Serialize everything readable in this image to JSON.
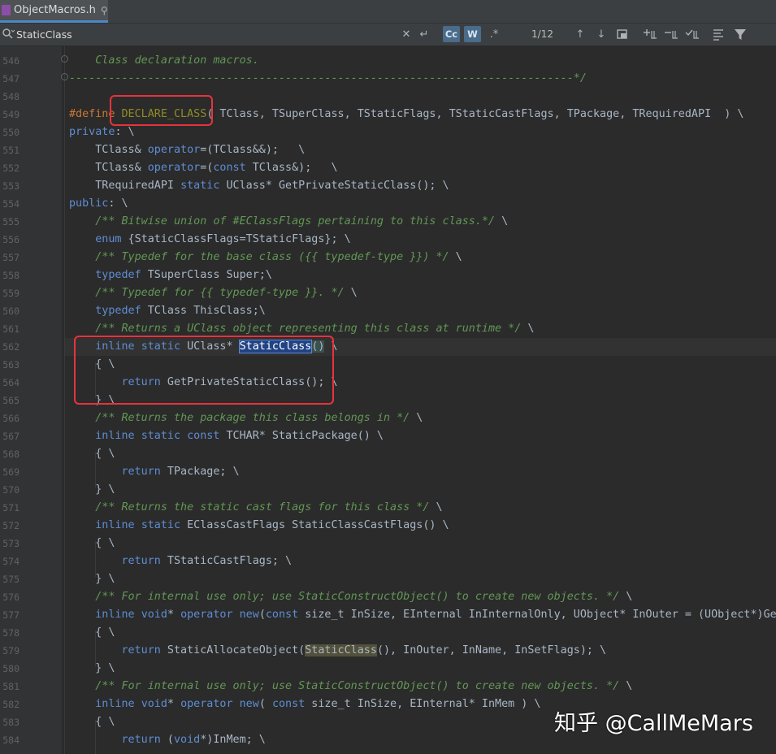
{
  "tab": {
    "title": "ObjectMacros.h",
    "pin_glyph": "⚲"
  },
  "search": {
    "query": "StaticClass",
    "match_case_label": "Cc",
    "words_label": "W",
    "regex_label": ".*",
    "match_count": "1/12"
  },
  "lines": [
    {
      "n": "546",
      "html": "    <span class=\"cm\">Class declaration macros.</span>"
    },
    {
      "n": "547",
      "html": "<span class=\"cm\">-----------------------------------------------------------------------------*/</span>"
    },
    {
      "n": "548",
      "html": ""
    },
    {
      "n": "549",
      "html": "<span class=\"kw\">#define</span> <span class=\"mac\">DECLARE_CLASS</span>( TClass, TSuperClass, TStaticFlags, TStaticCastFlags, TPackage, TRequiredAPI  ) \\"
    },
    {
      "n": "550",
      "html": "<span class=\"kwbl\">private</span>: \\"
    },
    {
      "n": "551",
      "html": "    TClass&amp; <span class=\"op\">operator</span>=(TClass&amp;&amp;);   \\"
    },
    {
      "n": "552",
      "html": "    TClass&amp; <span class=\"op\">operator</span>=(<span class=\"kwbl\">const</span> TClass&amp;);   \\"
    },
    {
      "n": "553",
      "html": "    TRequiredAPI <span class=\"kwbl\">static</span> UClass* GetPrivateStaticClass(); \\"
    },
    {
      "n": "554",
      "html": "<span class=\"kwbl\">public</span>: \\"
    },
    {
      "n": "555",
      "html": "    <span class=\"cm\">/** Bitwise union of #EClassFlags pertaining to this class.*/</span> \\"
    },
    {
      "n": "556",
      "html": "    <span class=\"kwbl\">enum</span> {StaticClassFlags=TStaticFlags}; \\"
    },
    {
      "n": "557",
      "html": "    <span class=\"cm\">/** Typedef for the base class ({{ typedef-type }}) */</span> \\"
    },
    {
      "n": "558",
      "html": "    <span class=\"kwbl\">typedef</span> TSuperClass Super;\\"
    },
    {
      "n": "559",
      "html": "    <span class=\"cm\">/** Typedef for {{ typedef-type }}. */</span> \\"
    },
    {
      "n": "560",
      "html": "    <span class=\"kwbl\">typedef</span> TClass ThisClass;\\"
    },
    {
      "n": "561",
      "html": "    <span class=\"cm\">/** Returns a UClass object representing this class at runtime */</span> \\"
    },
    {
      "n": "562",
      "html": "    <span class=\"kwbl\">inline</span> <span class=\"kwbl\">static</span> UClass* <span class=\"sel\">StaticClass</span><span class=\"paren\">()</span> \\"
    },
    {
      "n": "563",
      "html": "    { \\"
    },
    {
      "n": "564",
      "html": "        <span class=\"kwbl\">return</span> GetPrivateStaticClass(); \\"
    },
    {
      "n": "565",
      "html": "    } \\"
    },
    {
      "n": "566",
      "html": "    <span class=\"cm\">/** Returns the package this class belongs in */</span> \\"
    },
    {
      "n": "567",
      "html": "    <span class=\"kwbl\">inline</span> <span class=\"kwbl\">static</span> <span class=\"kwbl\">const</span> TCHAR* StaticPackage() \\"
    },
    {
      "n": "568",
      "html": "    { \\"
    },
    {
      "n": "569",
      "html": "        <span class=\"kwbl\">return</span> TPackage; \\"
    },
    {
      "n": "570",
      "html": "    } \\"
    },
    {
      "n": "571",
      "html": "    <span class=\"cm\">/** Returns the static cast flags for this class */</span> \\"
    },
    {
      "n": "572",
      "html": "    <span class=\"kwbl\">inline</span> <span class=\"kwbl\">static</span> EClassCastFlags StaticClassCastFlags() \\"
    },
    {
      "n": "573",
      "html": "    { \\"
    },
    {
      "n": "574",
      "html": "        <span class=\"kwbl\">return</span> TStaticCastFlags; \\"
    },
    {
      "n": "575",
      "html": "    } \\"
    },
    {
      "n": "576",
      "html": "    <span class=\"cm\">/** For internal use only; use StaticConstructObject() to create new objects. */</span> \\"
    },
    {
      "n": "577",
      "html": "    <span class=\"kwbl\">inline</span> <span class=\"kwbl\">void</span>* <span class=\"op\">operator</span> <span class=\"op\">new</span>(<span class=\"kwbl\">const</span> size_t InSize, EInternal InInternalOnly, UObject* InOuter = (UObject*)GetTransientPackage(), FName InName = NAME_None, EObjectFlags InSetFlags = RF_NoFlags) \\"
    },
    {
      "n": "578",
      "html": "    { \\"
    },
    {
      "n": "579",
      "html": "        <span class=\"kwbl\">return</span> StaticAllocateObject(<span class=\"hlword\">StaticClass</span>(), InOuter, InName, InSetFlags); \\"
    },
    {
      "n": "580",
      "html": "    } \\"
    },
    {
      "n": "581",
      "html": "    <span class=\"cm\">/** For internal use only; use StaticConstructObject() to create new objects. */</span> \\"
    },
    {
      "n": "582",
      "html": "    <span class=\"kwbl\">inline</span> <span class=\"kwbl\">void</span>* <span class=\"op\">operator</span> <span class=\"op\">new</span>( <span class=\"kwbl\">const</span> size_t InSize, EInternal* InMem ) \\"
    },
    {
      "n": "583",
      "html": "    { \\"
    },
    {
      "n": "584",
      "html": "        <span class=\"kwbl\">return</span> (<span class=\"kwbl\">void</span>*)InMem; \\"
    }
  ],
  "watermark": "知乎 @CallMeMars"
}
